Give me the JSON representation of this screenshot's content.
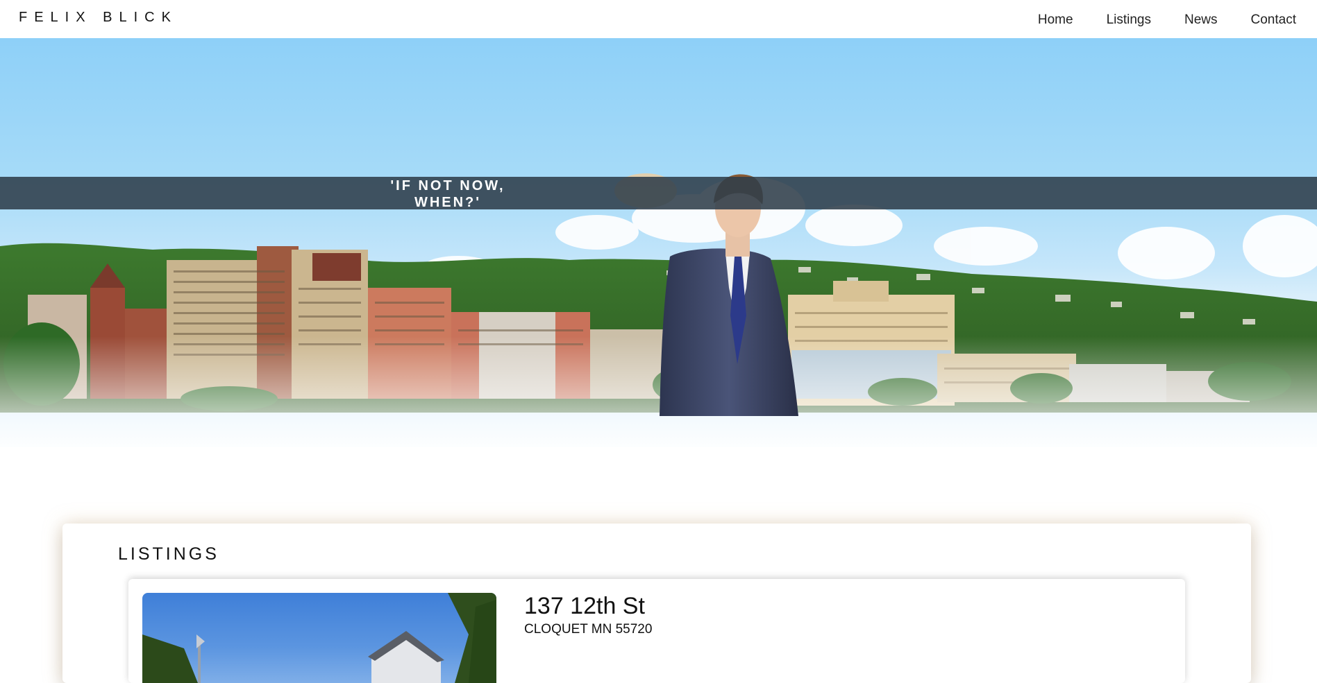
{
  "header": {
    "brand": "FELIX BLICK",
    "nav": [
      {
        "label": "Home"
      },
      {
        "label": "Listings"
      },
      {
        "label": "News"
      },
      {
        "label": "Contact"
      }
    ]
  },
  "hero": {
    "quote_line1": "'IF NOT NOW,",
    "quote_line2": "WHEN?'"
  },
  "listings": {
    "title": "LISTINGS",
    "items": [
      {
        "address": "137 12th St",
        "city_line": "CLOQUET MN 55720"
      }
    ]
  },
  "colors": {
    "sky": "#8ed0f8",
    "quote_band": "#2f3e4a",
    "card_glow": "#d6b078",
    "text": "#111111"
  }
}
